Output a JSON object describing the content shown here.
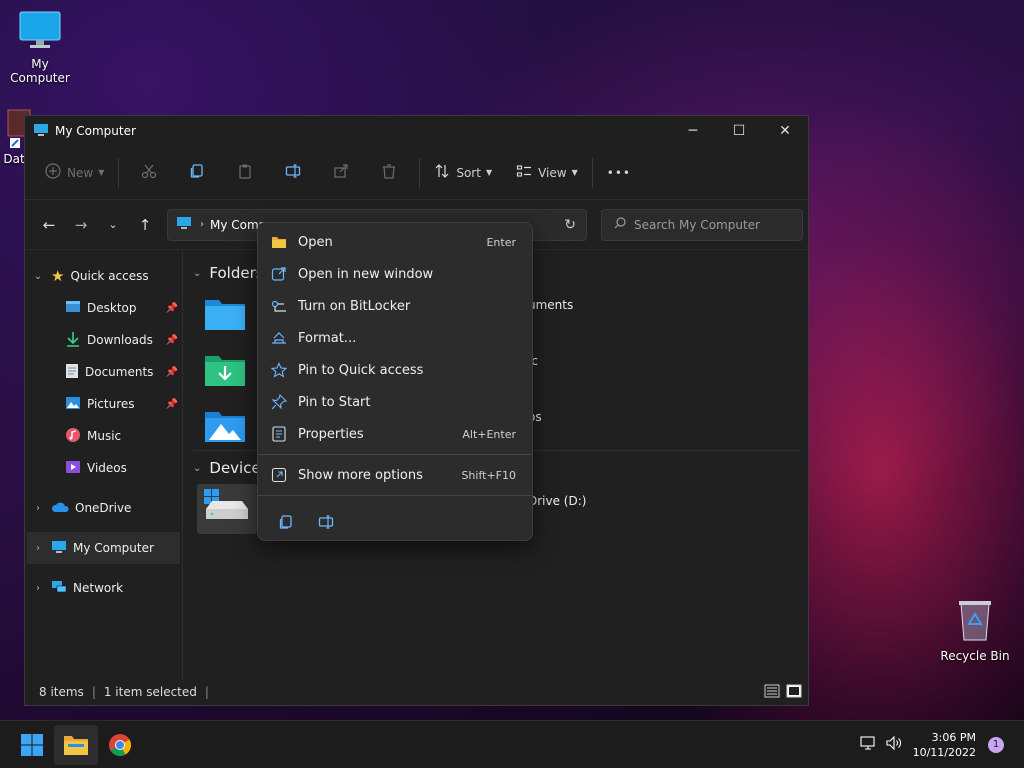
{
  "desktop": {
    "my_computer_label": "My Computer",
    "data_label_partial": "Data",
    "recycle_bin_label": "Recycle Bin"
  },
  "window": {
    "title": "My Computer",
    "minimize": "─",
    "maximize": "☐",
    "close": "✕"
  },
  "toolbar": {
    "new_label": "New",
    "sort_label": "Sort",
    "view_label": "View",
    "more_label": "•••"
  },
  "address": {
    "crumb": "My Comp",
    "search_placeholder": "Search My Computer"
  },
  "sidebar": {
    "items": [
      {
        "label": "Quick access"
      },
      {
        "label": "Desktop"
      },
      {
        "label": "Downloads"
      },
      {
        "label": "Documents"
      },
      {
        "label": "Pictures"
      },
      {
        "label": "Music"
      },
      {
        "label": "Videos"
      },
      {
        "label": "OneDrive"
      },
      {
        "label": "My Computer"
      },
      {
        "label": "Network"
      }
    ]
  },
  "content": {
    "folders_header": "Folders",
    "devices_header": "Devices",
    "partial_documents": "uments",
    "partial_music": "ic",
    "partial_videos": "os",
    "partial_drive": "Drive (D:)"
  },
  "context_menu": {
    "items": [
      {
        "label": "Open",
        "shortcut": "Enter"
      },
      {
        "label": "Open in new window",
        "shortcut": ""
      },
      {
        "label": "Turn on BitLocker",
        "shortcut": ""
      },
      {
        "label": "Format...",
        "shortcut": ""
      },
      {
        "label": "Pin to Quick access",
        "shortcut": ""
      },
      {
        "label": "Pin to Start",
        "shortcut": ""
      },
      {
        "label": "Properties",
        "shortcut": "Alt+Enter"
      },
      {
        "label": "Show more options",
        "shortcut": "Shift+F10"
      }
    ]
  },
  "status": {
    "items_count": "8 items",
    "selected": "1 item selected"
  },
  "taskbar": {
    "time": "3:06 PM",
    "date": "10/11/2022",
    "notification_count": "1"
  },
  "colors": {
    "accent": "#4cc2ff",
    "folder_yellow": "#f4c542",
    "window_bg": "#202020"
  }
}
